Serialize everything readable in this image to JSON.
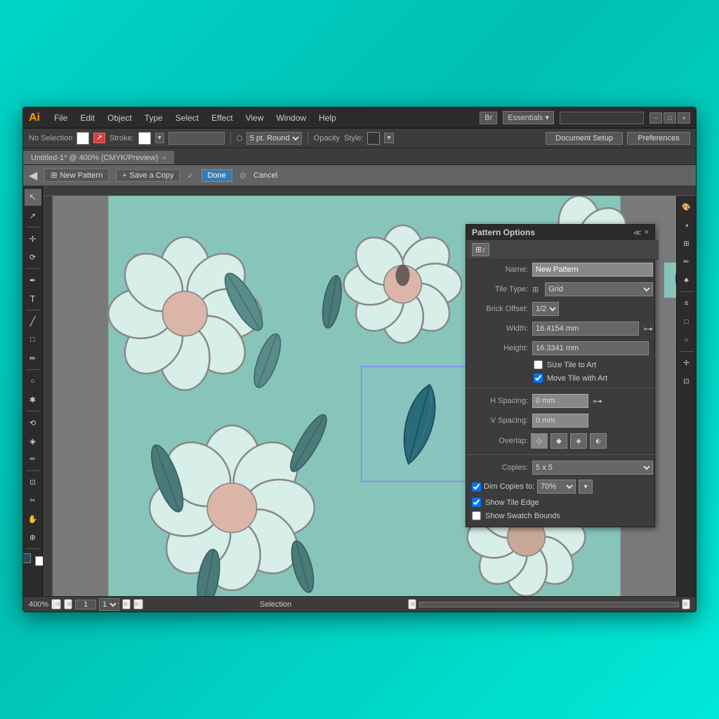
{
  "window": {
    "title": "Adobe Illustrator",
    "logo": "Ai",
    "controls": [
      "−",
      "□",
      "×"
    ]
  },
  "menubar": {
    "items": [
      "File",
      "Edit",
      "Object",
      "Type",
      "Select",
      "Effect",
      "View",
      "Window",
      "Help"
    ]
  },
  "toolbar_right": {
    "workspace_label": "Essentials",
    "bridge_label": "Br"
  },
  "options_bar": {
    "selection_label": "No Selection",
    "stroke_label": "Stroke:",
    "brush_label": "5 pt. Round",
    "opacity_label": "Opacity",
    "style_label": "Style:",
    "doc_setup_label": "Document Setup",
    "preferences_label": "Preferences"
  },
  "tab": {
    "title": "Untitled-1* @ 400% (CMYK/Preview)"
  },
  "pattern_bar": {
    "new_pattern_label": "New Pattern",
    "save_copy_label": "Save a Copy",
    "done_label": "Done",
    "cancel_label": "Cancel"
  },
  "canvas": {
    "zoom": "400%",
    "page": "1",
    "status": "Selection"
  },
  "pattern_panel": {
    "title": "Pattern Options",
    "name_label": "Name:",
    "name_value": "New Pattern",
    "tile_type_label": "Tile Type:",
    "tile_type_value": "Grid",
    "brick_offset_label": "Brick Offset:",
    "brick_offset_value": "1/2",
    "width_label": "Width:",
    "width_value": "16.4154 mm",
    "height_label": "Height:",
    "height_value": "16.3341 mm",
    "size_tile_label": "Size Tile to Art",
    "move_tile_label": "Move Tile with Art",
    "h_spacing_label": "H Spacing:",
    "h_spacing_value": "0 mm",
    "v_spacing_label": "V Spacing:",
    "v_spacing_value": "0 mm",
    "overlap_label": "Overlap:",
    "copies_label": "Copies:",
    "copies_value": "5 x 5",
    "dim_copies_label": "Dim Copies to:",
    "dim_copies_value": "70%",
    "show_tile_edge_label": "Show Tile Edge",
    "show_swatch_bounds_label": "Show Swatch Bounds"
  },
  "tools": {
    "items": [
      "↖",
      "↗",
      "✢",
      "✂",
      "⊕",
      "T",
      "╱",
      "□",
      "✒",
      "✏",
      "○",
      "✱",
      "⟲",
      "◈",
      "⊘",
      "⊡"
    ]
  }
}
